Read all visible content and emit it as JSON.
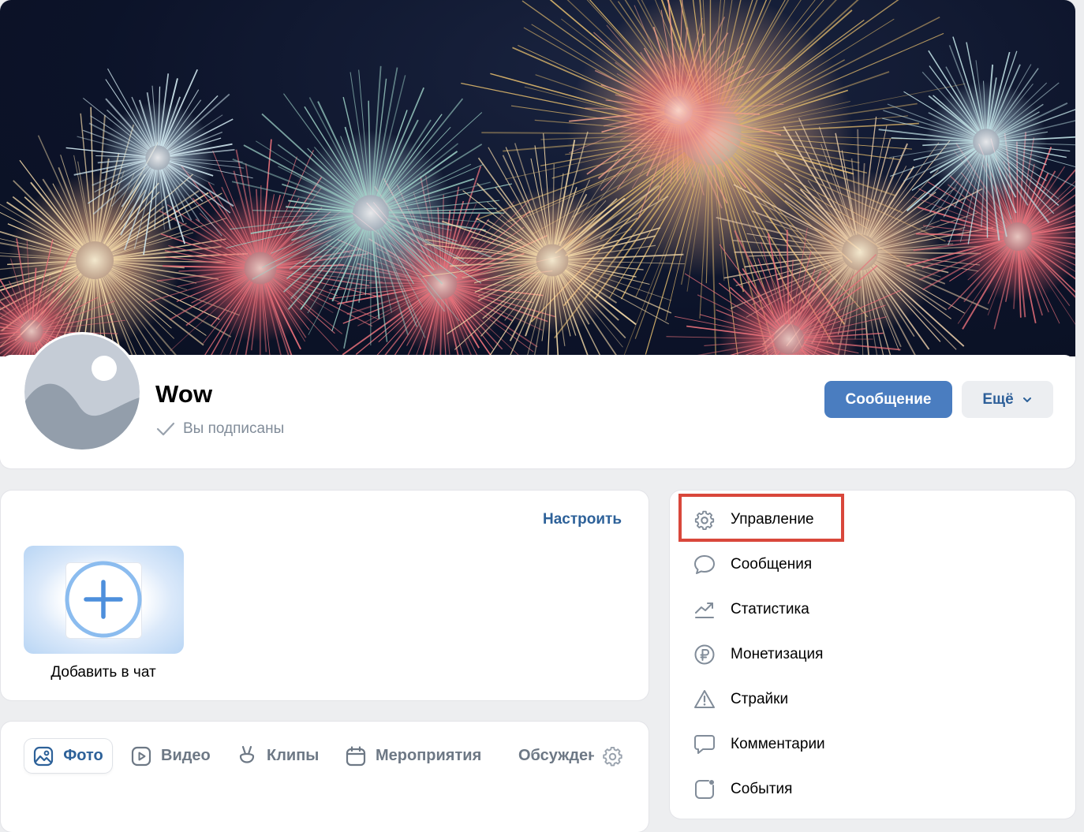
{
  "header": {
    "group_name": "Wow",
    "subscribed_label": "Вы подписаны",
    "message_button": "Сообщение",
    "more_button": "Ещё"
  },
  "chat": {
    "configure_link": "Настроить",
    "add_chat_label": "Добавить в чат"
  },
  "tabs": [
    {
      "label": "Фото",
      "icon": "photo-icon",
      "active": true
    },
    {
      "label": "Видео",
      "icon": "video-icon"
    },
    {
      "label": "Клипы",
      "icon": "clips-icon"
    },
    {
      "label": "Мероприятия",
      "icon": "calendar-icon"
    },
    {
      "label": "Обсуждения",
      "icon": "discussion-icon"
    }
  ],
  "side_menu": [
    {
      "label": "Управление",
      "icon": "gear-icon",
      "highlighted": true
    },
    {
      "label": "Сообщения",
      "icon": "message-bubble-icon"
    },
    {
      "label": "Статистика",
      "icon": "trend-chart-icon"
    },
    {
      "label": "Монетизация",
      "icon": "ruble-icon"
    },
    {
      "label": "Страйки",
      "icon": "warning-icon"
    },
    {
      "label": "Комментарии",
      "icon": "comment-icon"
    },
    {
      "label": "События",
      "icon": "events-square-icon"
    }
  ],
  "colors": {
    "primary_button": "#4a7dc0",
    "link": "#2d6199",
    "highlight_border": "#d9473b",
    "page_bg": "#edeef0"
  }
}
